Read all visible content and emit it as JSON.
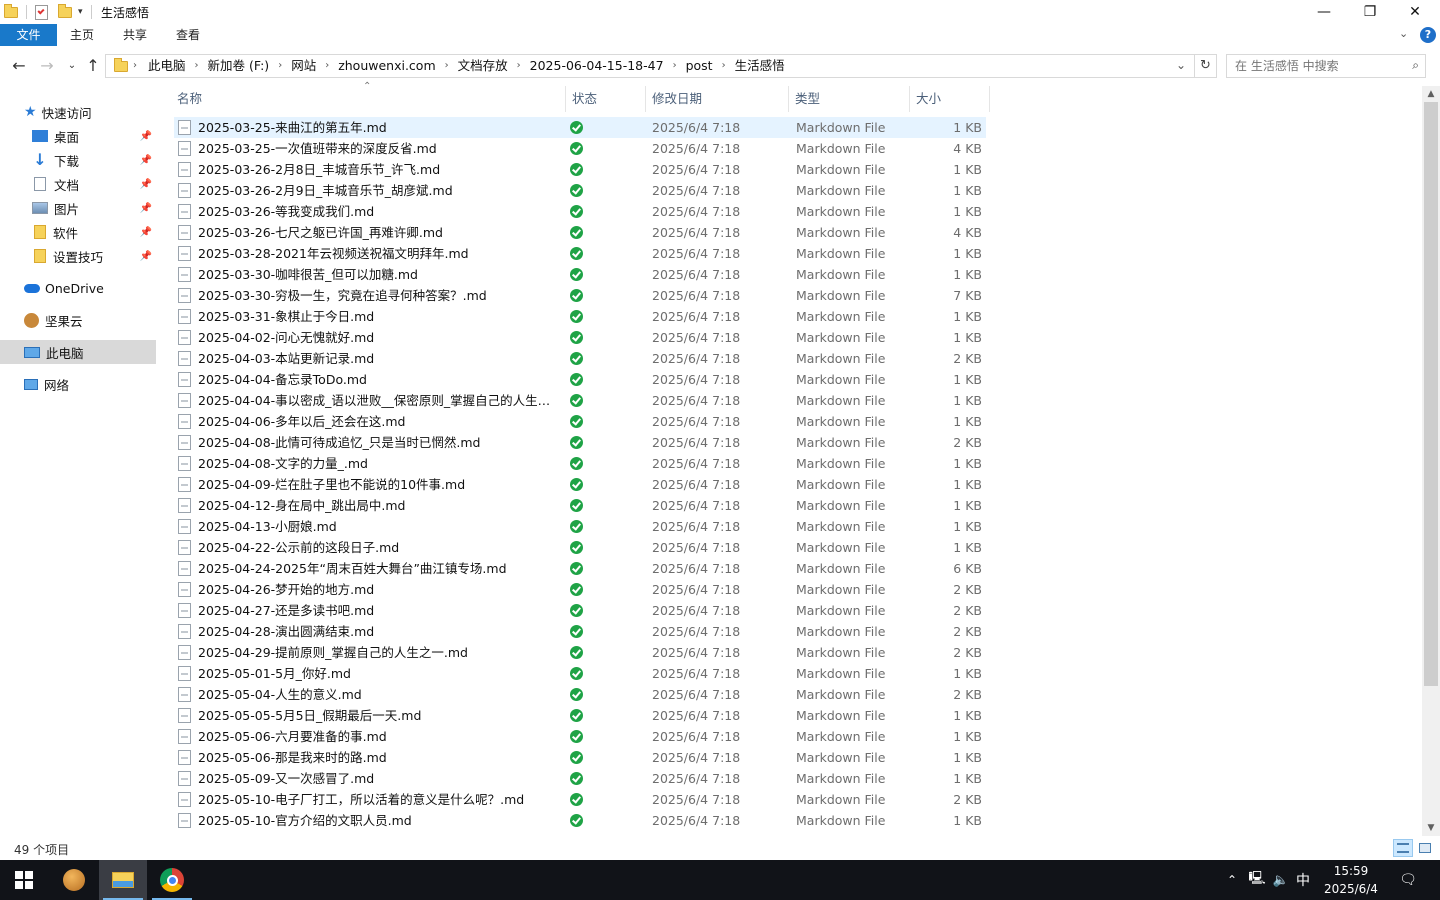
{
  "window": {
    "title": "生活感悟",
    "buttons": [
      "—",
      "❐",
      "✕"
    ]
  },
  "ribbon": {
    "tabs": [
      "文件",
      "主页",
      "共享",
      "查看"
    ],
    "help": "?"
  },
  "address": {
    "crumbs": [
      "此电脑",
      "新加卷 (F:)",
      "网站",
      "zhouwenxi.com",
      "文档存放",
      "2025-06-04-15-18-47",
      "post",
      "生活感悟"
    ],
    "search_placeholder": "在 生活感悟 中搜索"
  },
  "nav": {
    "quick_access": "快速访问",
    "pinned": [
      {
        "label": "桌面",
        "icon": "desktop-icon"
      },
      {
        "label": "下载",
        "icon": "download-icon"
      },
      {
        "label": "文档",
        "icon": "documents-icon"
      },
      {
        "label": "图片",
        "icon": "pictures-icon"
      },
      {
        "label": "软件",
        "icon": "folder-icon"
      },
      {
        "label": "设置技巧",
        "icon": "folder-icon"
      }
    ],
    "onedrive": "OneDrive",
    "jianguoyun": "坚果云",
    "this_pc": "此电脑",
    "network": "网络"
  },
  "columns": {
    "name": "名称",
    "status": "状态",
    "date": "修改日期",
    "type": "类型",
    "size": "大小"
  },
  "files": [
    {
      "name": "2025-03-25-来曲江的第五年.md",
      "date": "2025/6/4 7:18",
      "type": "Markdown File",
      "size": "1 KB"
    },
    {
      "name": "2025-03-25-一次值班带来的深度反省.md",
      "date": "2025/6/4 7:18",
      "type": "Markdown File",
      "size": "4 KB"
    },
    {
      "name": "2025-03-26-2月8日_丰城音乐节_许飞.md",
      "date": "2025/6/4 7:18",
      "type": "Markdown File",
      "size": "1 KB"
    },
    {
      "name": "2025-03-26-2月9日_丰城音乐节_胡彦斌.md",
      "date": "2025/6/4 7:18",
      "type": "Markdown File",
      "size": "1 KB"
    },
    {
      "name": "2025-03-26-等我变成我们.md",
      "date": "2025/6/4 7:18",
      "type": "Markdown File",
      "size": "1 KB"
    },
    {
      "name": "2025-03-26-七尺之躯已许国_再难许卿.md",
      "date": "2025/6/4 7:18",
      "type": "Markdown File",
      "size": "4 KB"
    },
    {
      "name": "2025-03-28-2021年云视频送祝福文明拜年.md",
      "date": "2025/6/4 7:18",
      "type": "Markdown File",
      "size": "1 KB"
    },
    {
      "name": "2025-03-30-咖啡很苦_但可以加糖.md",
      "date": "2025/6/4 7:18",
      "type": "Markdown File",
      "size": "1 KB"
    },
    {
      "name": "2025-03-30-穷极一生，究竟在追寻何种答案？.md",
      "date": "2025/6/4 7:18",
      "type": "Markdown File",
      "size": "7 KB"
    },
    {
      "name": "2025-03-31-象棋止于今日.md",
      "date": "2025/6/4 7:18",
      "type": "Markdown File",
      "size": "1 KB"
    },
    {
      "name": "2025-04-02-问心无愧就好.md",
      "date": "2025/6/4 7:18",
      "type": "Markdown File",
      "size": "1 KB"
    },
    {
      "name": "2025-04-03-本站更新记录.md",
      "date": "2025/6/4 7:18",
      "type": "Markdown File",
      "size": "2 KB"
    },
    {
      "name": "2025-04-04-备忘录ToDo.md",
      "date": "2025/6/4 7:18",
      "type": "Markdown File",
      "size": "1 KB"
    },
    {
      "name": "2025-04-04-事以密成_语以泄败__保密原则_掌握自己的人生之一....",
      "date": "2025/6/4 7:18",
      "type": "Markdown File",
      "size": "1 KB"
    },
    {
      "name": "2025-04-06-多年以后_还会在这.md",
      "date": "2025/6/4 7:18",
      "type": "Markdown File",
      "size": "1 KB"
    },
    {
      "name": "2025-04-08-此情可待成追忆_只是当时已惘然.md",
      "date": "2025/6/4 7:18",
      "type": "Markdown File",
      "size": "2 KB"
    },
    {
      "name": "2025-04-08-文字的力量_.md",
      "date": "2025/6/4 7:18",
      "type": "Markdown File",
      "size": "1 KB"
    },
    {
      "name": "2025-04-09-烂在肚子里也不能说的10件事.md",
      "date": "2025/6/4 7:18",
      "type": "Markdown File",
      "size": "1 KB"
    },
    {
      "name": "2025-04-12-身在局中_跳出局中.md",
      "date": "2025/6/4 7:18",
      "type": "Markdown File",
      "size": "1 KB"
    },
    {
      "name": "2025-04-13-小厨娘.md",
      "date": "2025/6/4 7:18",
      "type": "Markdown File",
      "size": "1 KB"
    },
    {
      "name": "2025-04-22-公示前的这段日子.md",
      "date": "2025/6/4 7:18",
      "type": "Markdown File",
      "size": "1 KB"
    },
    {
      "name": "2025-04-24-2025年“周末百姓大舞台”曲江镇专场.md",
      "date": "2025/6/4 7:18",
      "type": "Markdown File",
      "size": "6 KB"
    },
    {
      "name": "2025-04-26-梦开始的地方.md",
      "date": "2025/6/4 7:18",
      "type": "Markdown File",
      "size": "2 KB"
    },
    {
      "name": "2025-04-27-还是多读书吧.md",
      "date": "2025/6/4 7:18",
      "type": "Markdown File",
      "size": "2 KB"
    },
    {
      "name": "2025-04-28-演出圆满结束.md",
      "date": "2025/6/4 7:18",
      "type": "Markdown File",
      "size": "2 KB"
    },
    {
      "name": "2025-04-29-提前原则_掌握自己的人生之一.md",
      "date": "2025/6/4 7:18",
      "type": "Markdown File",
      "size": "2 KB"
    },
    {
      "name": "2025-05-01-5月_你好.md",
      "date": "2025/6/4 7:18",
      "type": "Markdown File",
      "size": "1 KB"
    },
    {
      "name": "2025-05-04-人生的意义.md",
      "date": "2025/6/4 7:18",
      "type": "Markdown File",
      "size": "2 KB"
    },
    {
      "name": "2025-05-05-5月5日_假期最后一天.md",
      "date": "2025/6/4 7:18",
      "type": "Markdown File",
      "size": "1 KB"
    },
    {
      "name": "2025-05-06-六月要准备的事.md",
      "date": "2025/6/4 7:18",
      "type": "Markdown File",
      "size": "1 KB"
    },
    {
      "name": "2025-05-06-那是我来时的路.md",
      "date": "2025/6/4 7:18",
      "type": "Markdown File",
      "size": "1 KB"
    },
    {
      "name": "2025-05-09-又一次感冒了.md",
      "date": "2025/6/4 7:18",
      "type": "Markdown File",
      "size": "1 KB"
    },
    {
      "name": "2025-05-10-电子厂打工，所以活着的意义是什么呢？.md",
      "date": "2025/6/4 7:18",
      "type": "Markdown File",
      "size": "2 KB"
    },
    {
      "name": "2025-05-10-官方介绍的文职人员.md",
      "date": "2025/6/4 7:18",
      "type": "Markdown File",
      "size": "1 KB"
    }
  ],
  "status": {
    "item_count": "49 个项目"
  },
  "taskbar": {
    "ime": "中",
    "time": "15:59",
    "date": "2025/6/4"
  },
  "colors": {
    "ribbon_file_tab": "#1979ca",
    "selection": "#e5f3ff",
    "sync_ok": "#1fa346",
    "taskbar": "#111318"
  }
}
